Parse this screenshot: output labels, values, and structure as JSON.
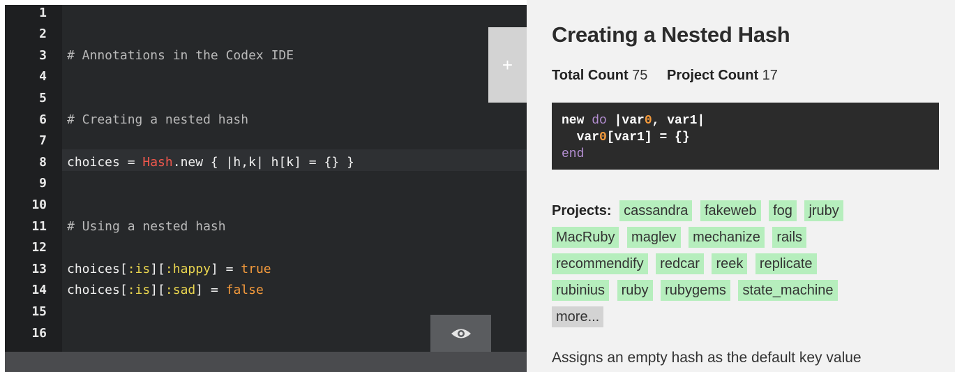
{
  "editor": {
    "line_numbers": [
      "1",
      "2",
      "3",
      "4",
      "5",
      "6",
      "7",
      "8",
      "9",
      "10",
      "11",
      "12",
      "13",
      "14",
      "15",
      "16"
    ],
    "comment_annotations": "# Annotations in the Codex IDE",
    "comment_creating": "# Creating a nested hash",
    "line8": {
      "ident": "choices = ",
      "class": "Hash",
      "rest": ".new { |h,k| h[k] = {} }"
    },
    "comment_using": "# Using a nested hash",
    "line13": {
      "ident": "choices[",
      "sym1": ":is",
      "mid": "][",
      "sym2": ":happy",
      "close": "] = ",
      "val": "true"
    },
    "line14": {
      "ident": "choices[",
      "sym1": ":is",
      "mid": "][",
      "sym2": ":sad",
      "close": "] = ",
      "val": "false"
    },
    "add_button_icon": "plus-icon",
    "toggle_icon": "eye-icon"
  },
  "panel": {
    "title": "Creating a Nested Hash",
    "total_count_label": "Total Count",
    "total_count": "75",
    "project_count_label": "Project Count",
    "project_count": "17",
    "snippet": {
      "l1_new": "new ",
      "l1_do": "do",
      "l1_a": " |var",
      "l1_zero": "0",
      "l1_b": ", var1|",
      "l2_a": "  var",
      "l2_zero": "0",
      "l2_b": "[var1] = {}",
      "l3_end": "end"
    },
    "projects_label": "Projects:",
    "projects": [
      "cassandra",
      "fakeweb",
      "fog",
      "jruby",
      "MacRuby",
      "maglev",
      "mechanize",
      "rails",
      "recommendify",
      "redcar",
      "reek",
      "replicate",
      "rubinius",
      "ruby",
      "rubygems",
      "state_machine"
    ],
    "more_label": "more...",
    "description": "Assigns an empty hash as the default key value"
  },
  "colors": {
    "gutter": "#1e1f21",
    "editor_bg": "#26282a",
    "panel_bg": "#f2f2f2",
    "tag_bg": "#b6eebd",
    "class_red": "#f1584d",
    "symbol_yellow": "#e9d54f",
    "boolean_orange": "#f49a3c",
    "keyword_purple": "#b58fd3"
  }
}
